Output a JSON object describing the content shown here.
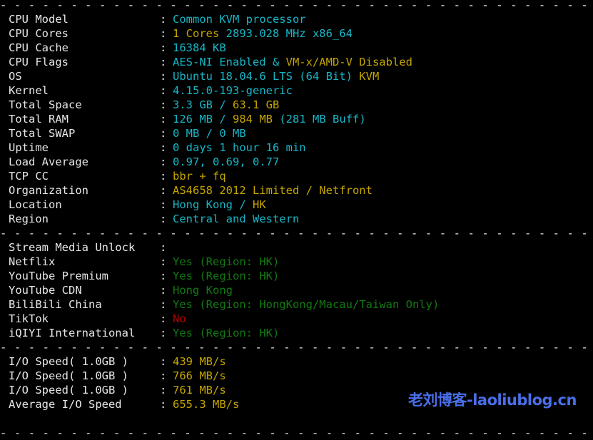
{
  "separator": "- - - - - - - - - - - - - - - - - - - - - - - - - - - - - - - - - - - - - - - - - - - - - - - - - - - - - - - - - - - - - - - - - - - - - - - - - -",
  "system_info": [
    {
      "label": "CPU Model",
      "parts": [
        {
          "text": "Common KVM processor",
          "color": "cyan"
        }
      ]
    },
    {
      "label": "CPU Cores",
      "parts": [
        {
          "text": "1 Cores ",
          "color": "yellow"
        },
        {
          "text": "2893.028 MHz x86_64",
          "color": "cyan"
        }
      ]
    },
    {
      "label": "CPU Cache",
      "parts": [
        {
          "text": "16384 KB",
          "color": "cyan"
        }
      ]
    },
    {
      "label": "CPU Flags",
      "parts": [
        {
          "text": "AES-NI Enabled & ",
          "color": "cyan"
        },
        {
          "text": "VM-x/AMD-V Disabled",
          "color": "yellow"
        }
      ]
    },
    {
      "label": "OS",
      "parts": [
        {
          "text": "Ubuntu 18.04.6 LTS (64 Bit) ",
          "color": "cyan"
        },
        {
          "text": "KVM",
          "color": "yellow"
        }
      ]
    },
    {
      "label": "Kernel",
      "parts": [
        {
          "text": "4.15.0-193-generic",
          "color": "cyan"
        }
      ]
    },
    {
      "label": "Total Space",
      "parts": [
        {
          "text": "3.3 GB / ",
          "color": "cyan"
        },
        {
          "text": "63.1 GB",
          "color": "yellow"
        }
      ]
    },
    {
      "label": "Total RAM",
      "parts": [
        {
          "text": "126 MB / ",
          "color": "cyan"
        },
        {
          "text": "984 MB",
          "color": "yellow"
        },
        {
          "text": " (281 MB Buff)",
          "color": "cyan"
        }
      ]
    },
    {
      "label": "Total SWAP",
      "parts": [
        {
          "text": "0 MB / 0 MB",
          "color": "cyan"
        }
      ]
    },
    {
      "label": "Uptime",
      "parts": [
        {
          "text": "0 days 1 hour 16 min",
          "color": "cyan"
        }
      ]
    },
    {
      "label": "Load Average",
      "parts": [
        {
          "text": "0.97, 0.69, 0.77",
          "color": "cyan"
        }
      ]
    },
    {
      "label": "TCP CC",
      "parts": [
        {
          "text": "bbr + fq",
          "color": "yellow"
        }
      ]
    },
    {
      "label": "Organization",
      "parts": [
        {
          "text": "AS4658 2012 Limited / Netfront",
          "color": "yellow"
        }
      ]
    },
    {
      "label": "Location",
      "parts": [
        {
          "text": "Hong Kong / ",
          "color": "cyan"
        },
        {
          "text": "HK",
          "color": "yellow"
        }
      ]
    },
    {
      "label": "Region",
      "parts": [
        {
          "text": "Central and Western",
          "color": "cyan"
        }
      ]
    }
  ],
  "stream_media": [
    {
      "label": "Stream Media Unlock",
      "parts": []
    },
    {
      "label": "Netflix",
      "parts": [
        {
          "text": "Yes (Region: HK)",
          "color": "green"
        }
      ]
    },
    {
      "label": "YouTube Premium",
      "parts": [
        {
          "text": "Yes (Region: HK)",
          "color": "green"
        }
      ]
    },
    {
      "label": "YouTube CDN",
      "parts": [
        {
          "text": "Hong Kong",
          "color": "green"
        }
      ]
    },
    {
      "label": "BiliBili China",
      "parts": [
        {
          "text": "Yes (Region: HongKong/Macau/Taiwan Only)",
          "color": "green"
        }
      ]
    },
    {
      "label": "TikTok",
      "parts": [
        {
          "text": "No",
          "color": "red"
        }
      ]
    },
    {
      "label": "iQIYI International",
      "parts": [
        {
          "text": "Yes (Region: HK)",
          "color": "green"
        }
      ]
    }
  ],
  "io_speed": [
    {
      "label": "I/O Speed( 1.0GB )",
      "parts": [
        {
          "text": "439 MB/s",
          "color": "yellow"
        }
      ]
    },
    {
      "label": "I/O Speed( 1.0GB )",
      "parts": [
        {
          "text": "766 MB/s",
          "color": "yellow"
        }
      ]
    },
    {
      "label": "I/O Speed( 1.0GB )",
      "parts": [
        {
          "text": "761 MB/s",
          "color": "yellow"
        }
      ]
    },
    {
      "label": "Average I/O Speed",
      "parts": [
        {
          "text": "655.3 MB/s",
          "color": "yellow"
        }
      ]
    }
  ],
  "colon": ":",
  "watermark": "老刘博客-laoliublog.cn"
}
